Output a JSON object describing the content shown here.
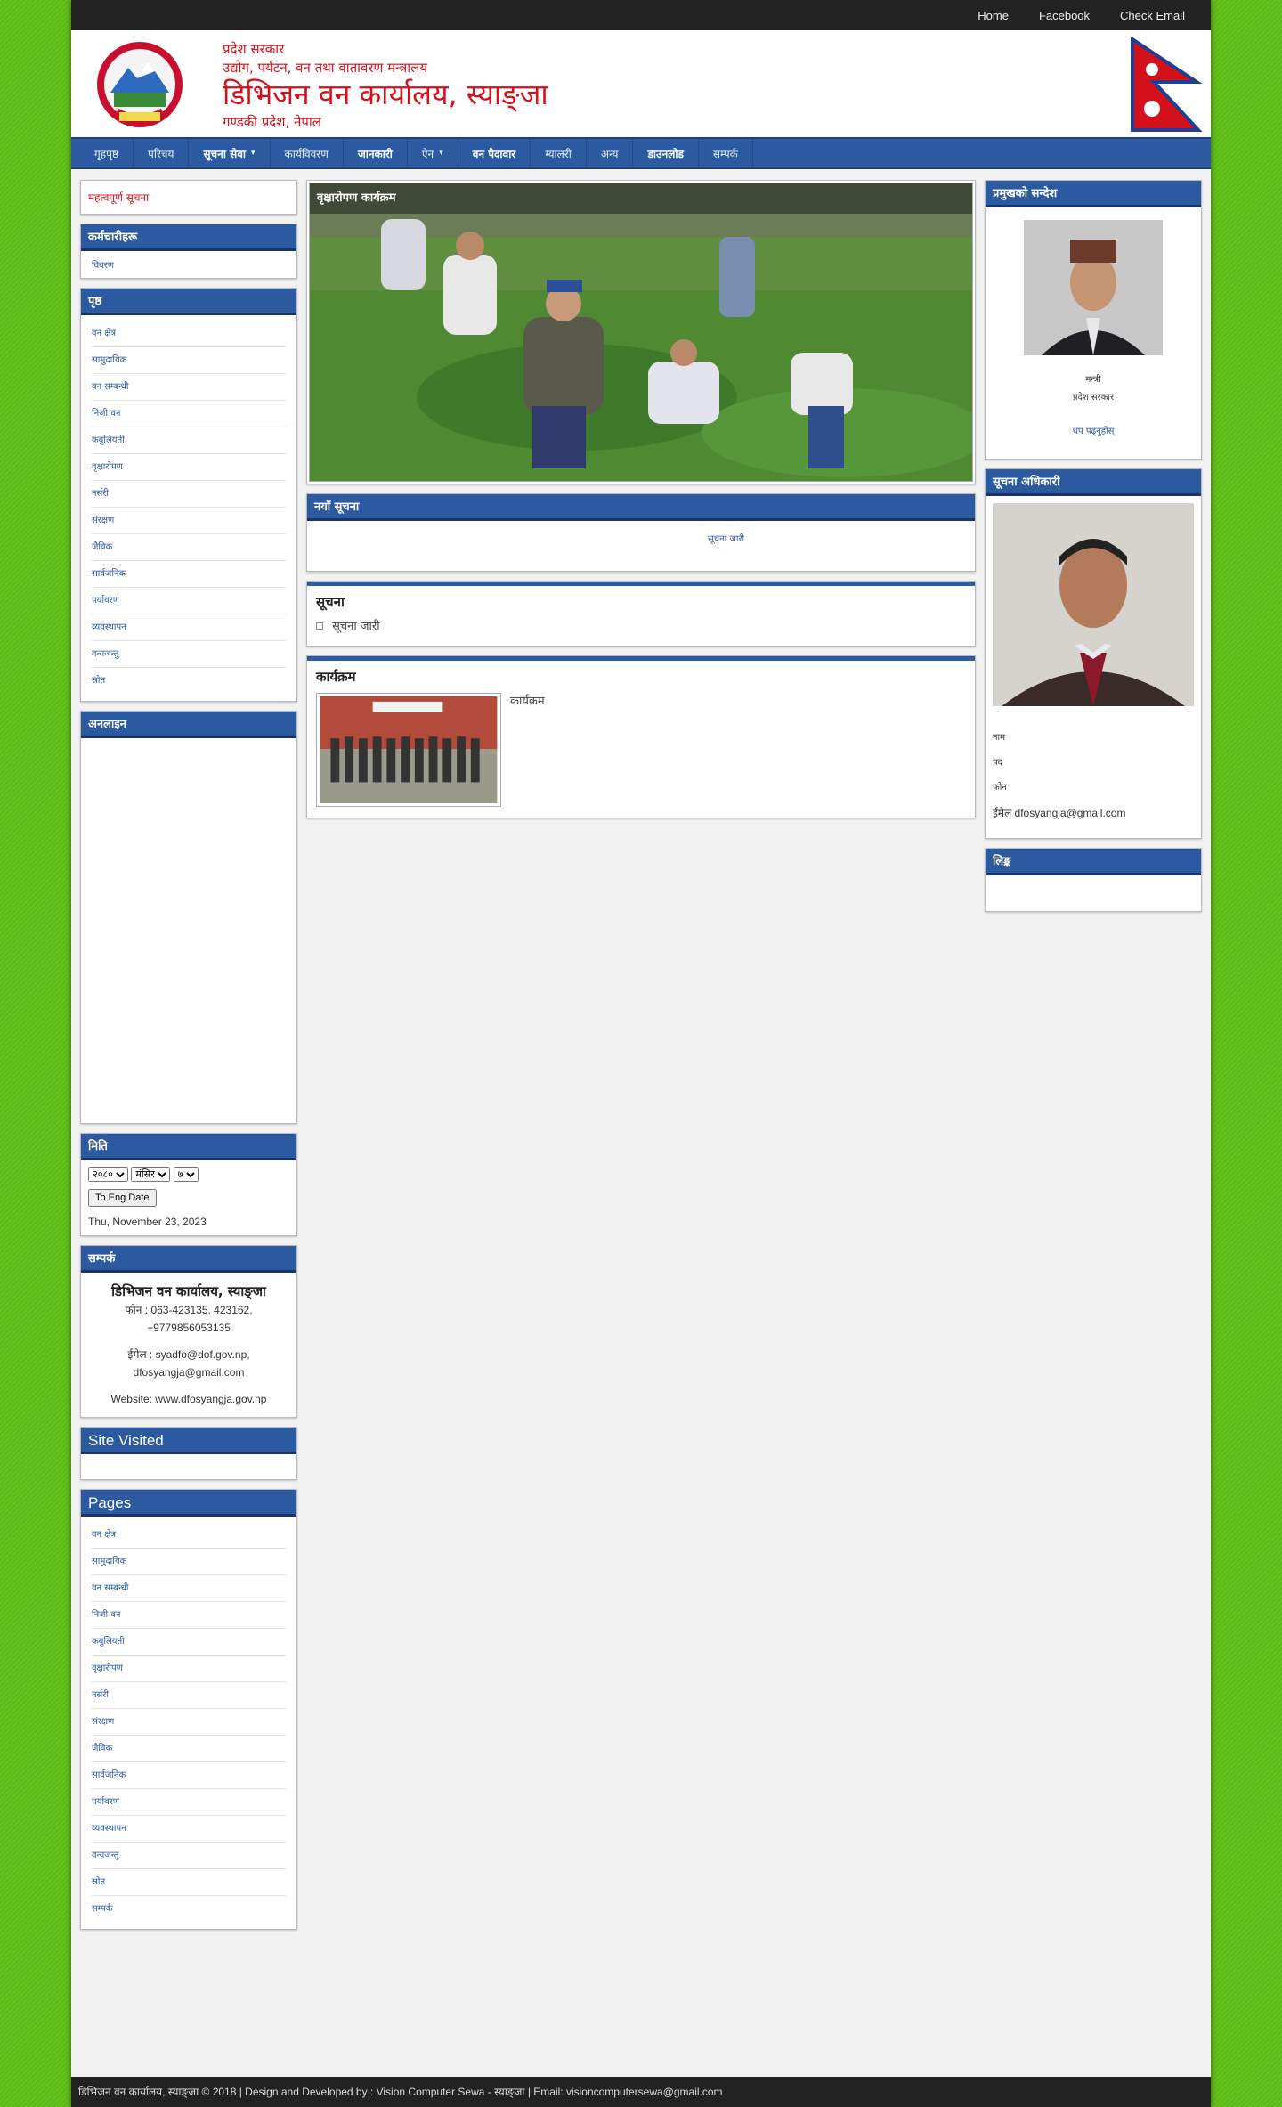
{
  "topnav": {
    "home": "Home",
    "facebook": "Facebook",
    "check_email": "Check Email"
  },
  "header": {
    "line1": "प्रदेश सरकार",
    "line2": "उद्योग, पर्यटन, वन तथा वातावरण मन्त्रालय",
    "title": "डिभिजन वन कार्यालय, स्याङ्जा",
    "line4": "गण्डकी प्रदेश, नेपाल"
  },
  "nav": [
    {
      "label": "गृहपृष्ठ",
      "bold": false,
      "dropdown": false
    },
    {
      "label": "परिचय",
      "bold": false,
      "dropdown": false
    },
    {
      "label": "सूचना सेवा",
      "bold": true,
      "dropdown": true
    },
    {
      "label": "कार्यविवरण",
      "bold": false,
      "dropdown": false
    },
    {
      "label": "जानकारी",
      "bold": true,
      "dropdown": false
    },
    {
      "label": "ऐन",
      "bold": false,
      "dropdown": true
    },
    {
      "label": "वन पैदावार",
      "bold": true,
      "dropdown": false
    },
    {
      "label": "ग्यालरी",
      "bold": false,
      "dropdown": false
    },
    {
      "label": "अन्य",
      "bold": false,
      "dropdown": false
    },
    {
      "label": "डाउनलोड",
      "bold": true,
      "dropdown": false
    },
    {
      "label": "सम्पर्क",
      "bold": false,
      "dropdown": false
    }
  ],
  "left": {
    "red_link": "महत्वपूर्ण सूचना",
    "box1_title": "कर्मचारीहरू",
    "box1_link": "विवरण",
    "box2_title": "पृष्ठ",
    "box2_links": [
      "वन क्षेत्र",
      "सामुदायिक",
      "वन सम्बन्धी",
      "निजी वन",
      "कबुलियती",
      "वृक्षारोपण",
      "नर्सरी",
      "संरक्षण",
      "जैविक",
      "सार्वजनिक",
      "पर्यावरण",
      "व्यवस्थापन",
      "वन्यजन्तु",
      "स्रोत"
    ],
    "box3_title": "अनलाइन",
    "date_title": "मिति",
    "date_btn": "To Eng Date",
    "date_text": "Thu, November 23, 2023",
    "contact_title": "सम्पर्क",
    "contact_org": "डिभिजन वन कार्यालय, स्याङ्जा",
    "contact_phone": "फोन : 063-423135, 423162, +9779856053135",
    "contact_email": "ईमेल : syadfo@dof.gov.np, dfosyangja@gmail.com",
    "contact_web": "Website: www.dfosyangja.gov.np",
    "visited_title": "Site Visited",
    "pages_title": "Pages",
    "pages_links": [
      "वन क्षेत्र",
      "सामुदायिक",
      "वन सम्बन्धी",
      "निजी वन",
      "कबुलियती",
      "वृक्षारोपण",
      "नर्सरी",
      "संरक्षण",
      "जैविक",
      "सार्वजनिक",
      "पर्यावरण",
      "व्यवस्थापन",
      "वन्यजन्तु",
      "स्रोत",
      "सम्पर्क"
    ]
  },
  "center": {
    "slider_caption": "वृक्षारोपण कार्यक्रम",
    "news_title": "नयाँ सूचना",
    "ticker": "सूचना जारी",
    "post1_title": "सूचना",
    "post1_text": "सूचना जारी",
    "post2_title": "कार्यक्रम",
    "post2_text": "कार्यक्रम"
  },
  "right": {
    "msg_title": "प्रमुखको सन्देश",
    "msg_name": "मन्त्री",
    "msg_role": "प्रदेश सरकार",
    "msg_link": "थप पढ्नुहोस्",
    "officer_title": "सूचना अधिकारी",
    "officer_name": "नाम",
    "officer_role": "पद",
    "officer_phone": "फोन",
    "officer_email": "ईमेल dfosyangja@gmail.com",
    "links_title": "लिङ्क"
  },
  "footer": "डिभिजन वन कार्यालय, स्याङ्जा © 2018 | Design and Developed by : Vision Computer Sewa - स्याङ्जा | Email: visioncomputersewa@gmail.com",
  "colors": {
    "accent": "#2b5aa0",
    "brand_red": "#d4111b",
    "background": "#5fbf17"
  }
}
